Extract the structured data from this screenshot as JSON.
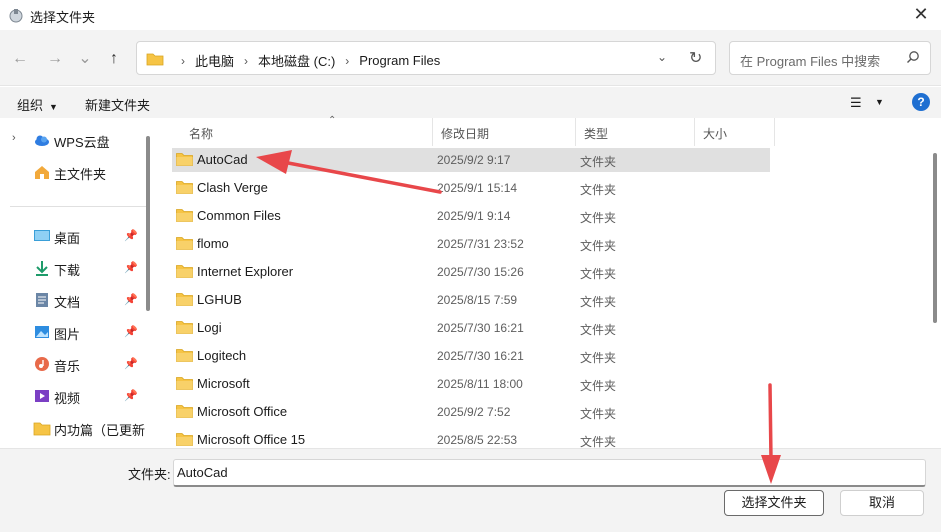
{
  "window": {
    "title": "选择文件夹",
    "close_glyph": "✕"
  },
  "nav": {
    "back_glyph": "←",
    "forward_glyph": "→",
    "recent_glyph": "⌄",
    "up_glyph": "↑",
    "breadcrumbs": [
      "此电脑",
      "本地磁盘 (C:)",
      "Program Files"
    ],
    "search_placeholder": "在 Program Files 中搜索"
  },
  "toolbar": {
    "organize": "组织",
    "new_folder": "新建文件夹",
    "view_glyph": "☰",
    "help_glyph": "?"
  },
  "sidebar": {
    "items": [
      {
        "label": "WPS云盘",
        "icon": "cloud-icon",
        "expandable": true
      },
      {
        "label": "主文件夹",
        "icon": "home-icon"
      },
      {
        "label": "桌面",
        "icon": "desktop-icon",
        "pinned": true
      },
      {
        "label": "下载",
        "icon": "download-icon",
        "pinned": true
      },
      {
        "label": "文档",
        "icon": "document-icon",
        "pinned": true
      },
      {
        "label": "图片",
        "icon": "pictures-icon",
        "pinned": true
      },
      {
        "label": "音乐",
        "icon": "music-icon",
        "pinned": true
      },
      {
        "label": "视频",
        "icon": "video-icon",
        "pinned": true
      },
      {
        "label": "内功篇（已更新",
        "icon": "folder-icon"
      }
    ]
  },
  "columns": {
    "name": "名称",
    "modified": "修改日期",
    "type": "类型",
    "size": "大小"
  },
  "files": [
    {
      "name": "AutoCad",
      "modified": "2025/9/2 9:17",
      "type": "文件夹",
      "selected": true
    },
    {
      "name": "Clash Verge",
      "modified": "2025/9/1 15:14",
      "type": "文件夹"
    },
    {
      "name": "Common Files",
      "modified": "2025/9/1 9:14",
      "type": "文件夹"
    },
    {
      "name": "flomo",
      "modified": "2025/7/31 23:52",
      "type": "文件夹"
    },
    {
      "name": "Internet Explorer",
      "modified": "2025/7/30 15:26",
      "type": "文件夹"
    },
    {
      "name": "LGHUB",
      "modified": "2025/8/15 7:59",
      "type": "文件夹"
    },
    {
      "name": "Logi",
      "modified": "2025/7/30 16:21",
      "type": "文件夹"
    },
    {
      "name": "Logitech",
      "modified": "2025/7/30 16:21",
      "type": "文件夹"
    },
    {
      "name": "Microsoft",
      "modified": "2025/8/11 18:00",
      "type": "文件夹"
    },
    {
      "name": "Microsoft Office",
      "modified": "2025/9/2 7:52",
      "type": "文件夹"
    },
    {
      "name": "Microsoft Office 15",
      "modified": "2025/8/5 22:53",
      "type": "文件夹"
    }
  ],
  "footer": {
    "folder_label": "文件夹:",
    "folder_value": "AutoCad",
    "select_button": "选择文件夹",
    "cancel_button": "取消"
  },
  "colors": {
    "selection": "#e0e0e0",
    "folder": "#f6c445",
    "accent": "#1f6fd1",
    "annotation_arrow": "#e8474a"
  }
}
